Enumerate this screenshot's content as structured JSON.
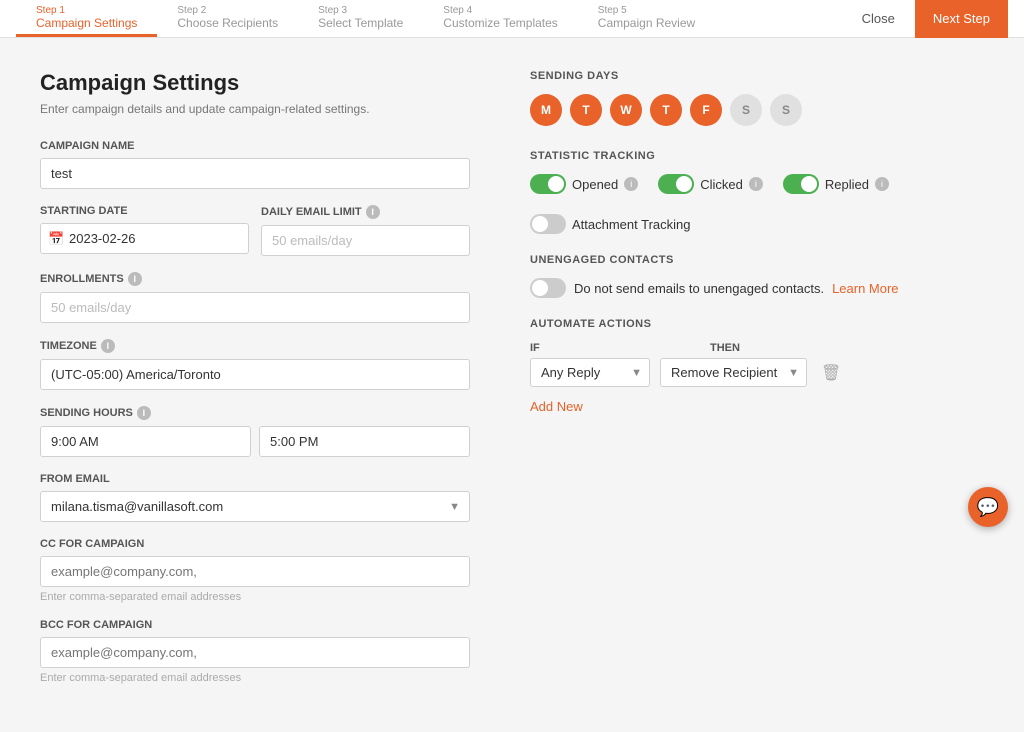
{
  "topnav": {
    "steps": [
      {
        "number": "Step 1",
        "label": "Campaign Settings",
        "active": true
      },
      {
        "number": "Step 2",
        "label": "Choose Recipients",
        "active": false
      },
      {
        "number": "Step 3",
        "label": "Select Template",
        "active": false
      },
      {
        "number": "Step 4",
        "label": "Customize Templates",
        "active": false
      },
      {
        "number": "Step 5",
        "label": "Campaign Review",
        "active": false
      }
    ],
    "close_label": "Close",
    "next_step_label": "Next Step"
  },
  "page": {
    "title": "Campaign Settings",
    "subtitle": "Enter campaign details and update campaign-related settings."
  },
  "form": {
    "campaign_name_label": "Campaign Name",
    "campaign_name_value": "test",
    "starting_date_label": "Starting Date",
    "starting_date_value": "2023-02-26",
    "daily_email_limit_label": "Daily Email Limit",
    "daily_email_limit_placeholder": "50 emails/day",
    "enrollments_label": "Enrollments",
    "enrollments_placeholder": "50 emails/day",
    "timezone_label": "Timezone",
    "timezone_value": "(UTC-05:00) America/Toronto",
    "sending_hours_label": "Sending Hours",
    "sending_hours_start": "9:00 AM",
    "sending_hours_end": "5:00 PM",
    "from_email_label": "From Email",
    "from_email_value": "milana.tisma@vanillasoft.com",
    "cc_label": "CC for Campaign",
    "cc_placeholder": "example@company.com,",
    "cc_hint": "Enter comma-separated email addresses",
    "bcc_label": "BCC for Campaign",
    "bcc_placeholder": "example@company.com,",
    "bcc_hint": "Enter comma-separated email addresses"
  },
  "right": {
    "sending_days_label": "Sending Days",
    "days": [
      {
        "letter": "M",
        "active": true
      },
      {
        "letter": "T",
        "active": true
      },
      {
        "letter": "W",
        "active": true
      },
      {
        "letter": "T",
        "active": true
      },
      {
        "letter": "F",
        "active": true
      },
      {
        "letter": "S",
        "active": false
      },
      {
        "letter": "S",
        "active": false
      }
    ],
    "stat_tracking_label": "Statistic Tracking",
    "toggles": [
      {
        "label": "Opened",
        "on": true
      },
      {
        "label": "Clicked",
        "on": true
      },
      {
        "label": "Replied",
        "on": true
      },
      {
        "label": "Attachment Tracking",
        "on": false
      }
    ],
    "unengaged_label": "Unengaged Contacts",
    "unengaged_text": "Do not send emails to unengaged contacts.",
    "learn_more": "Learn More",
    "automate_label": "Automate Actions",
    "if_label": "IF",
    "then_label": "THEN",
    "if_value": "Any Reply",
    "then_value": "Remove Recipient",
    "add_new_label": "Add New"
  }
}
